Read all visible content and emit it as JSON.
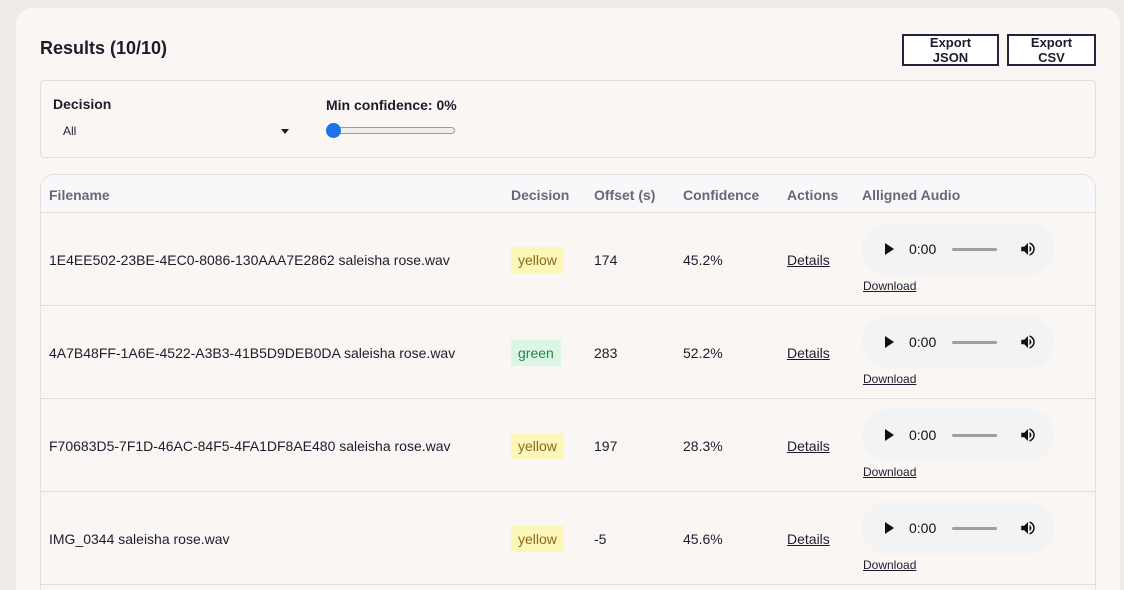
{
  "header": {
    "title": "Results (10/10)",
    "export_json_label": "Export JSON",
    "export_csv_label": "Export CSV"
  },
  "filters": {
    "decision_label": "Decision",
    "decision_value": "All",
    "confidence_label": "Min confidence: 0%",
    "confidence_min": 0
  },
  "table": {
    "columns": [
      "Filename",
      "Decision",
      "Offset (s)",
      "Confidence",
      "Actions",
      "Alligned Audio"
    ],
    "rows": [
      {
        "filename": "1E4EE502-23BE-4EC0-8086-130AAA7E2862 saleisha rose.wav",
        "decision": "yellow",
        "offset": "174",
        "confidence": "45.2%",
        "action": "Details",
        "time": "0:00",
        "download": "Download"
      },
      {
        "filename": "4A7B48FF-1A6E-4522-A3B3-41B5D9DEB0DA saleisha rose.wav",
        "decision": "green",
        "offset": "283",
        "confidence": "52.2%",
        "action": "Details",
        "time": "0:00",
        "download": "Download"
      },
      {
        "filename": "F70683D5-7F1D-46AC-84F5-4FA1DF8AE480 saleisha rose.wav",
        "decision": "yellow",
        "offset": "197",
        "confidence": "28.3%",
        "action": "Details",
        "time": "0:00",
        "download": "Download"
      },
      {
        "filename": "IMG_0344 saleisha rose.wav",
        "decision": "yellow",
        "offset": "-5",
        "confidence": "45.6%",
        "action": "Details",
        "time": "0:00",
        "download": "Download"
      }
    ]
  },
  "colors": {
    "accent": "#1a73e8",
    "yellow_badge": "#fdf6b9",
    "green_badge": "#dcf6e6"
  },
  "icons": [
    "caret-down-icon",
    "play-icon",
    "volume-icon"
  ]
}
